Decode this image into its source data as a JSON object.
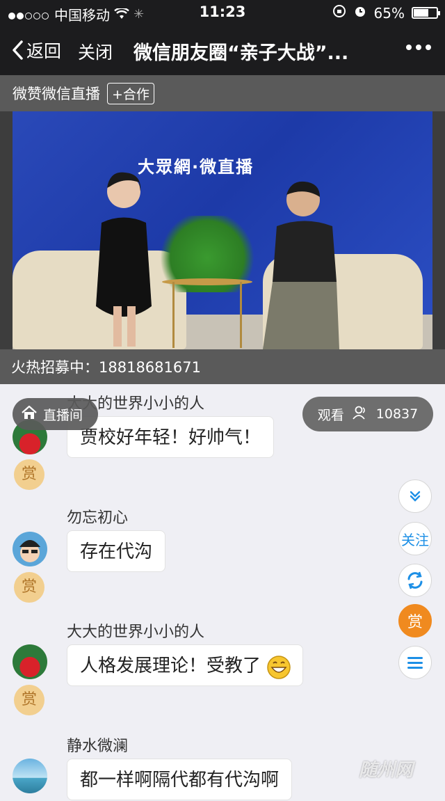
{
  "status": {
    "carrier": "中国移动",
    "time": "11:23",
    "battery": "65%",
    "battery_level": 0.65,
    "signal_dots_filled": 2,
    "signal_dots_total": 5
  },
  "nav": {
    "back_label": "返回",
    "close_label": "关闭",
    "title": "微信朋友圈“亲子大战”..."
  },
  "live_header": {
    "channel_name": "微赞微信直播",
    "coop_label": "+合作"
  },
  "video": {
    "banner_text": "大眾網·微直播"
  },
  "recruit": {
    "text": "火热招募中：18818681671"
  },
  "overlay": {
    "live_room_label": "直播间",
    "viewers_label": "观看",
    "viewers_count": "10837"
  },
  "messages": [
    {
      "name": "大大的世界小小的人",
      "text": "贾校好年轻！好帅气！",
      "reward": "赏"
    },
    {
      "name": "勿忘初心",
      "text": "存在代沟",
      "reward": "赏"
    },
    {
      "name": "大大的世界小小的人",
      "text": "人格发展理论！受教了",
      "reward": "赏"
    },
    {
      "name": "静水微澜",
      "text": "都一样啊隔代都有代沟啊"
    }
  ],
  "fabs": {
    "follow_label": "关注",
    "reward_label": "赏"
  },
  "watermark": "随州网",
  "colors": {
    "accent_blue": "#1c8fe6",
    "reward_orange": "#f08a1f",
    "reward_badge": "#f2cf8f"
  }
}
